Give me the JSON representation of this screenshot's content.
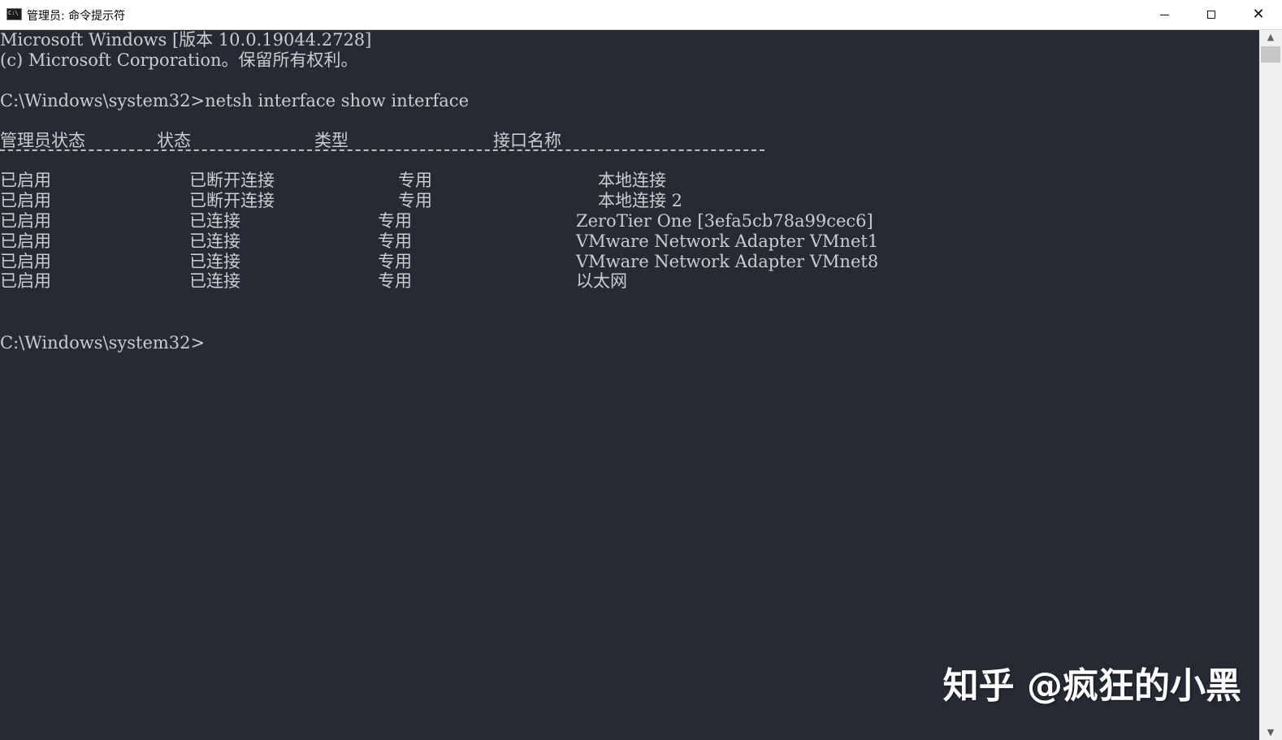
{
  "window": {
    "title": "管理员: 命令提示符",
    "icon": "cmd-icon",
    "controls": {
      "minimize": "minimize-icon",
      "maximize": "maximize-icon",
      "close": "close-icon"
    }
  },
  "console": {
    "banner_line1": "Microsoft Windows [版本 10.0.19044.2728]",
    "banner_line2": "(c) Microsoft Corporation。保留所有权利。",
    "command_line": "C:\\Windows\\system32>netsh interface show interface",
    "table": {
      "headers": [
        "管理员状态",
        "状态",
        "类型",
        "接口名称"
      ],
      "separator": "-------------------------------------------------------------------------",
      "rows": [
        [
          "已启用",
          "已断开连接",
          "专用",
          "本地连接"
        ],
        [
          "已启用",
          "已断开连接",
          "专用",
          "本地连接 2"
        ],
        [
          "已启用",
          "已连接",
          "专用",
          "ZeroTier One [3efa5cb78a99cec6]"
        ],
        [
          "已启用",
          "已连接",
          "专用",
          "VMware Network Adapter VMnet1"
        ],
        [
          "已启用",
          "已连接",
          "专用",
          "VMware Network Adapter VMnet8"
        ],
        [
          "已启用",
          "已连接",
          "专用",
          "以太网"
        ]
      ]
    },
    "prompt": "C:\\Windows\\system32>"
  },
  "watermark": "知乎 @疯狂的小黑",
  "colors": {
    "console_bg": "#262a35",
    "console_text": "#cccccc",
    "titlebar_bg": "#ffffff"
  }
}
